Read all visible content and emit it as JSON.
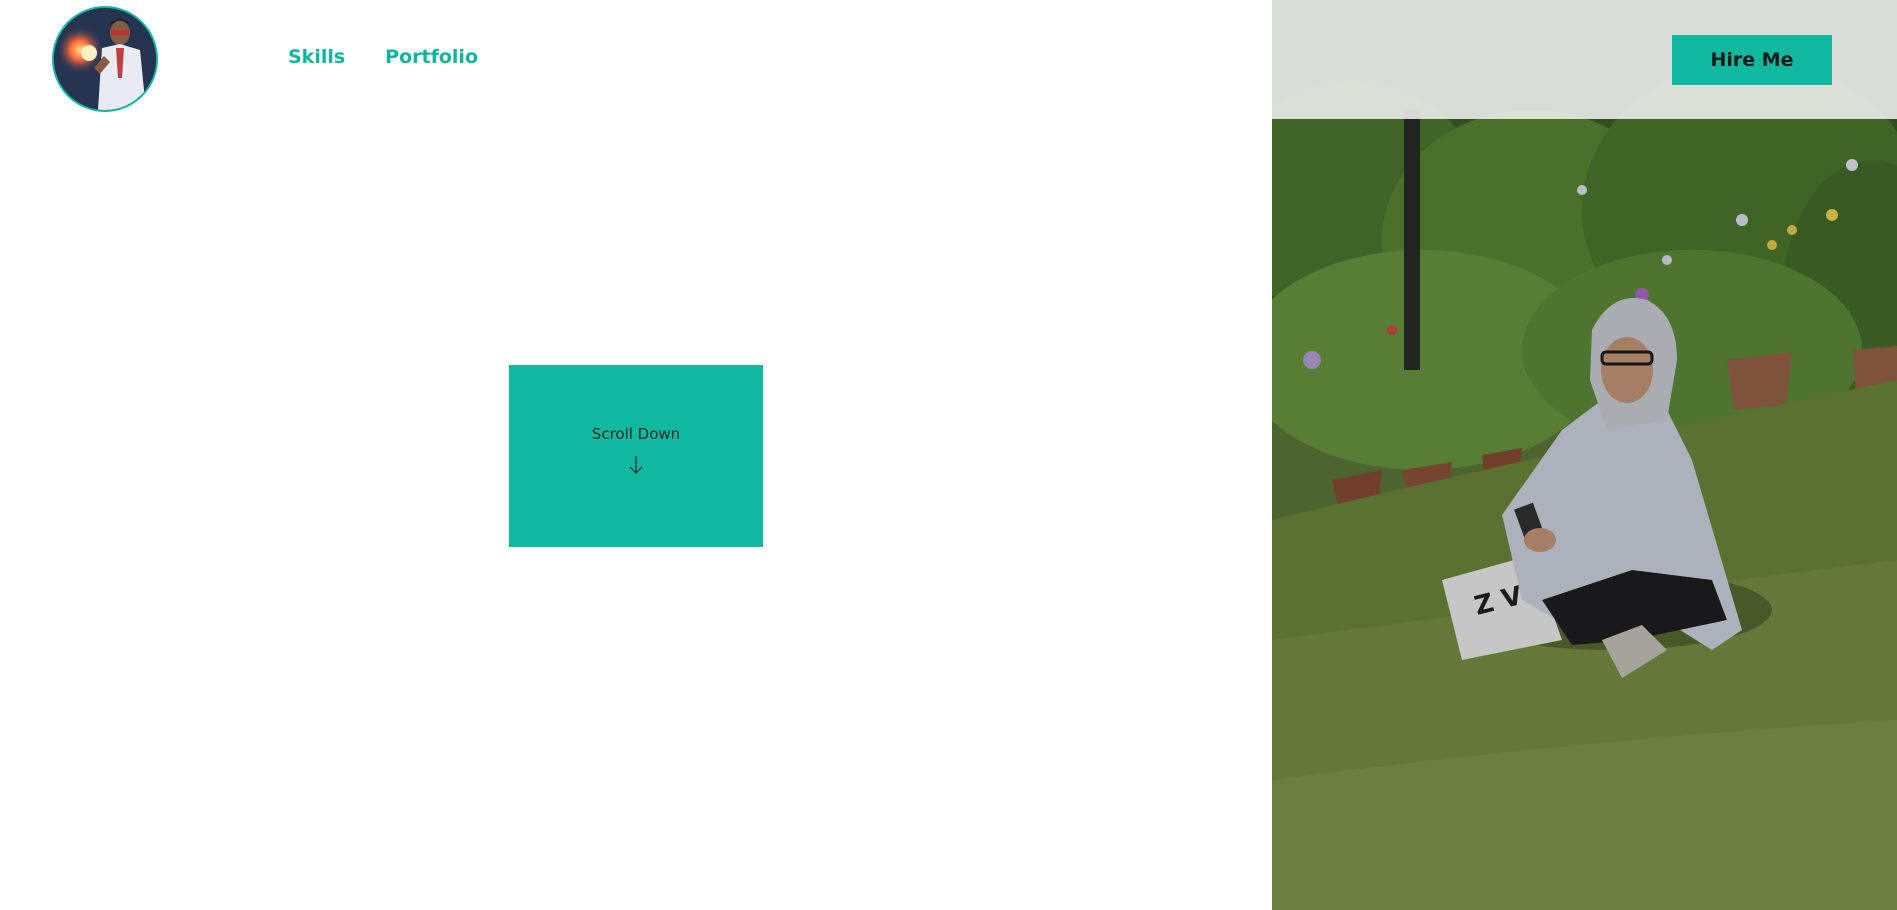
{
  "nav": {
    "items": [
      {
        "label": "Skills"
      },
      {
        "label": "Portfolio"
      }
    ]
  },
  "header": {
    "hire_label": "Hire Me",
    "avatar_icon": "avatar-scientist-icon"
  },
  "hero": {
    "scroll_label": "Scroll Down",
    "scroll_icon": "arrow-down-icon"
  },
  "colors": {
    "accent": "#10b8a0",
    "nav_text": "#0fb59c",
    "background": "#ffffff"
  }
}
